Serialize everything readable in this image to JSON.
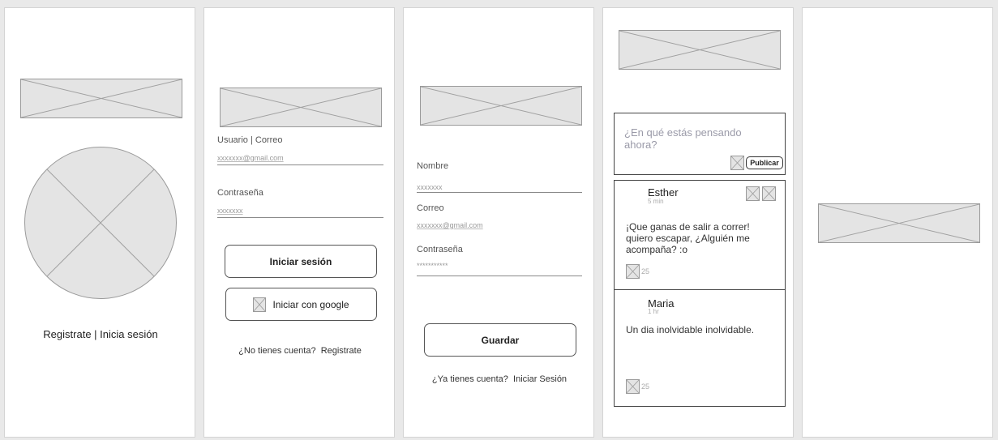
{
  "screen1": {
    "footer_text": "Registrate | Inicia sesión"
  },
  "login": {
    "user_label": "Usuario | Correo",
    "user_placeholder": "xxxxxxx@gmail.com",
    "password_label": "Contraseña",
    "password_placeholder": "xxxxxxx",
    "login_button": "Iniciar sesión",
    "google_button": "Iniciar con google",
    "no_account_text": "¿No tienes cuenta?",
    "register_link": "Registrate"
  },
  "register": {
    "name_label": "Nombre",
    "name_placeholder": "xxxxxxx",
    "email_label": "Correo",
    "email_placeholder": "xxxxxxx@gmail.com",
    "password_label": "Contraseña",
    "password_placeholder": "***********",
    "save_button": "Guardar",
    "have_account_text": "¿Ya tienes cuenta?",
    "login_link": "Iniciar Sesión"
  },
  "feed": {
    "composer_placeholder": "¿En qué estás pensando ahora?",
    "publish_button": "Publicar",
    "posts": [
      {
        "author": "Esther",
        "time": "5 min",
        "text": "¡Que ganas de salir a correr! quiero escapar, ¿Alguién me acompaña? :o",
        "likes": "25"
      },
      {
        "author": "Maria",
        "time": "1 hr",
        "text": "Un dia inolvidable inolvidable.",
        "likes": "25"
      }
    ]
  }
}
